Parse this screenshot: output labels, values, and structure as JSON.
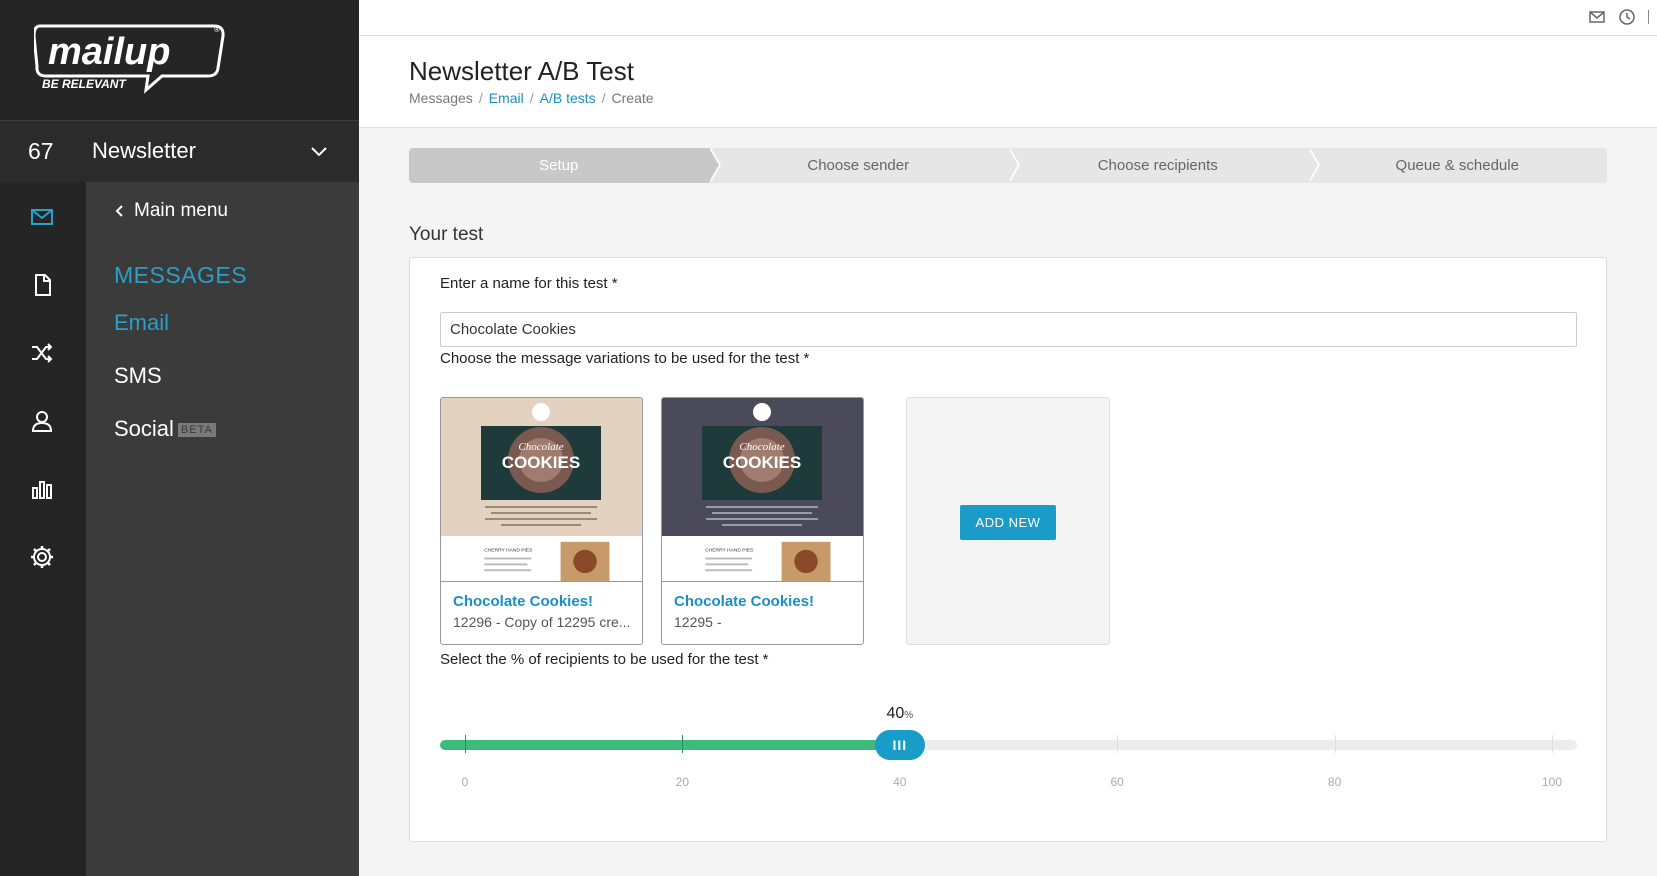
{
  "brand": {
    "logo_text": "mailup",
    "tagline": "BE RELEVANT"
  },
  "account": {
    "number": "67",
    "name": "Newsletter"
  },
  "rail_icons": [
    "mail-icon",
    "document-icon",
    "shuffle-icon",
    "user-icon",
    "bar-chart-icon",
    "gear-icon"
  ],
  "menu": {
    "back_label": "Main menu",
    "section": "MESSAGES",
    "items": [
      {
        "label": "Email",
        "active": true
      },
      {
        "label": "SMS",
        "active": false
      },
      {
        "label": "Social",
        "badge": "BETA",
        "active": false
      }
    ]
  },
  "header": {
    "title": "Newsletter A/B Test",
    "breadcrumb": [
      "Messages",
      "Email",
      "A/B tests",
      "Create"
    ]
  },
  "steps": [
    "Setup",
    "Choose sender",
    "Choose recipients",
    "Queue & schedule"
  ],
  "active_step": 0,
  "form": {
    "section_title": "Your test",
    "name_label": "Enter a name for this test *",
    "name_value": "Chocolate Cookies",
    "variations_label": "Choose the message variations to be used for the test *",
    "variations": [
      {
        "title": "Chocolate Cookies!",
        "subtitle": "12296 - Copy of 12295 cre...",
        "theme": "light"
      },
      {
        "title": "Chocolate Cookies!",
        "subtitle": "12295 -",
        "theme": "dark"
      }
    ],
    "add_new_label": "ADD NEW",
    "recipients_label": "Select the % of recipients to be used for the test *",
    "recipients_percent": 40,
    "percent_unit": "%",
    "tick_labels": [
      "0",
      "20",
      "40",
      "60",
      "80",
      "100"
    ],
    "thumb_text": {
      "headline": "COOKIES",
      "sub": "Chocolate",
      "section": "CHERRY HAND PIES"
    }
  },
  "colors": {
    "accent": "#1a9cc9",
    "fill": "#3dbb7d",
    "sidebar": "#252525",
    "menu": "#3b3b3b"
  }
}
